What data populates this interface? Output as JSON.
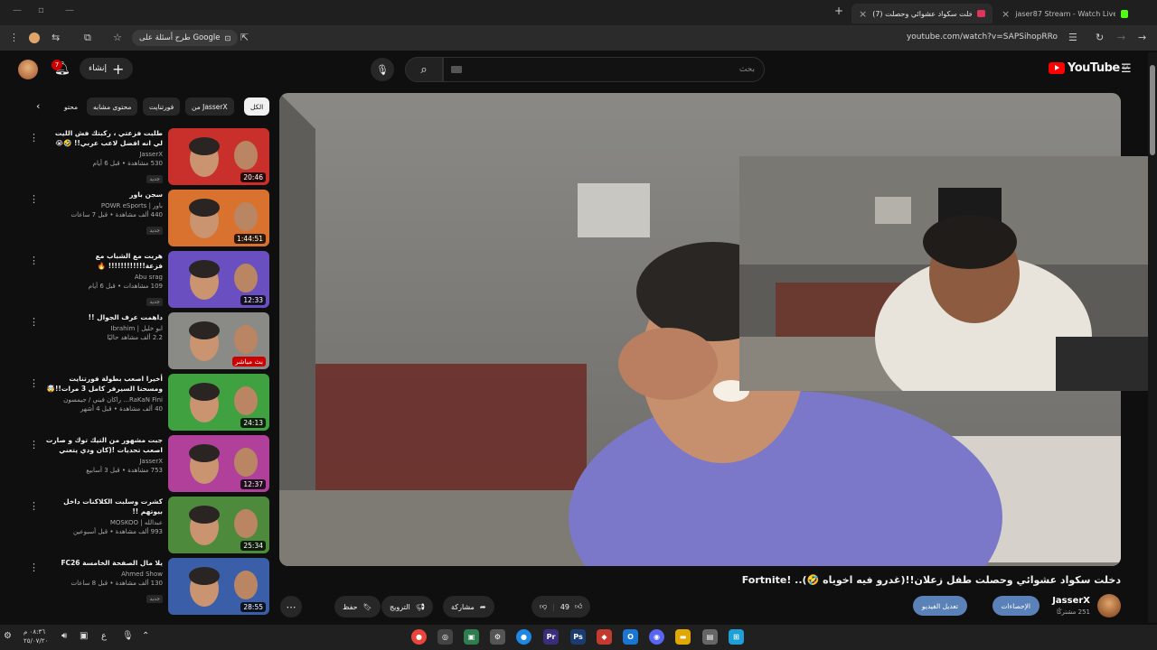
{
  "browser": {
    "tabs": [
      {
        "title": "jaser87 Stream - Watch Live on",
        "active": false
      },
      {
        "title": "(7) دخلت سكواد عشوائي وحصلت",
        "active": true
      }
    ],
    "url": "youtube.com/watch?v=SAPSihopRRo",
    "google_pill": "طرح أسئلة على Google"
  },
  "header": {
    "notif_count": "7",
    "create_label": "إنشاء",
    "search_placeholder": "بحث",
    "logo_text": "YouTube",
    "region": "SA"
  },
  "chips": [
    "الكل",
    "من JasserX",
    "فورتنايت",
    "محتوى مشابه",
    "محتو"
  ],
  "recommendations": [
    {
      "title": "طلبت فزعتي ، ركبتك فش الليت لي انه افضل لاعب عربي!! 🤣😭",
      "channel": "JasserX",
      "stats": "530 مشاهدة • قبل 6 أيام",
      "badge": "جديد",
      "duration": "20:46",
      "thumb_color": "#c9302c"
    },
    {
      "title": "سجن باور",
      "channel": "باور | POWR eSports",
      "stats": "440 ألف مشاهدة • قبل 7 ساعات",
      "badge": "جديد",
      "duration": "1:44:51",
      "thumb_color": "#d9722e"
    },
    {
      "title": "هربت مع الشباب مع فزعة!!!!!!!!!!!! 🔥",
      "channel": "Abu srag",
      "stats": "109 مشاهدات • قبل 6 أيام",
      "badge": "جديد",
      "duration": "12:33",
      "thumb_color": "#6a4fc0"
    },
    {
      "title": "داهمت عرف الجوال !!",
      "channel": "ابو خليل | Ibrahim",
      "stats": "2.2 ألف مشاهد حاليًا",
      "badge": "",
      "duration": "بث مباشر",
      "thumb_color": "#8a8a86"
    },
    {
      "title": "أخيرا اصعب بطولة فورتنايت ومسحنا السيرفر كامل 3 مرات!!🤯 🔥",
      "channel": "RaKaN Fini... راكان فيني / جيمسون",
      "stats": "40 ألف مشاهدة • قبل 4 أشهر",
      "badge": "",
      "duration": "24:13",
      "thumb_color": "#3fa13f"
    },
    {
      "title": "جبت مشهور من التيك توك و صارت اصعب تحديات !(كان ودي يتعني عليه)!! 😭 💔",
      "channel": "JasserX",
      "stats": "753 مشاهدة • قبل 3 أسابيع",
      "badge": "",
      "duration": "12:37",
      "thumb_color": "#b0409a"
    },
    {
      "title": "كشرت وسلبت الكلاكنات داخل بيوتهم !!",
      "channel": "عبدالله | MOSKOO",
      "stats": "993 ألف مشاهدة • قبل أسبوعين",
      "badge": "",
      "duration": "25:34",
      "thumb_color": "#4e8a3c"
    },
    {
      "title": "يلا مال الصفحة الخامسة FC26",
      "channel": "Ahmed Show",
      "stats": "130 ألف مشاهدة • قبل 8 ساعات",
      "badge": "جديد",
      "duration": "28:55",
      "thumb_color": "#3a5fa8"
    }
  ],
  "video": {
    "title": "دخلت سكواد عشوائي وحصلت طفل زعلان!!(غدرو فيه اخوياه 🤣).. !Fortnite",
    "channel": "JasserX",
    "subs": "251 مشتركًا",
    "likes": "49",
    "share_label": "مشاركة",
    "promote_label": "الترويج",
    "save_label": "حفظ",
    "stats_btn": "الإحصاءات",
    "edit_btn": "تعديل الفيديو"
  },
  "taskbar": {
    "time": "٠٨:٣٦ م",
    "date": "٢٥/٠٧/٢٠"
  }
}
